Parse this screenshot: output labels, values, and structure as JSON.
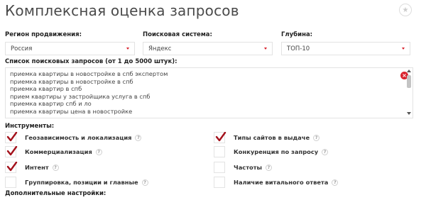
{
  "page": {
    "title": "Комплексная оценка запросов"
  },
  "header": {
    "star_icon": "star-icon"
  },
  "filters": {
    "region": {
      "label": "Регион продвижения:",
      "value": "Россия"
    },
    "engine": {
      "label": "Поисковая система:",
      "value": "Яндекс"
    },
    "depth": {
      "label": "Глубина:",
      "value": "ТОП-10"
    }
  },
  "queries": {
    "label": "Список поисковых запросов (от 1 до 5000 штук):",
    "lines": [
      "приемка квартиры в новостройке в спб экспертом",
      "приемка квартиры в новостройке в спб",
      "приемка квартир в спб",
      "прием квартиры у застройщика услуга в спб",
      "приемка квартир спб и ло",
      "приемка квартиры цена в новостройке"
    ]
  },
  "tools": {
    "label": "Инструменты:",
    "help_glyph": "?",
    "items": [
      {
        "label": "Геозависимость и локализация",
        "checked": true
      },
      {
        "label": "Коммерциализация",
        "checked": true
      },
      {
        "label": "Интент",
        "checked": true
      },
      {
        "label": "Группировка, позиции и главные",
        "checked": false
      },
      {
        "label": "Типы сайтов в выдаче",
        "checked": true
      },
      {
        "label": "Конкуренция по запросу",
        "checked": false
      },
      {
        "label": "Частоты",
        "checked": false
      },
      {
        "label": "Наличие витального ответа",
        "checked": false
      }
    ]
  },
  "extra": {
    "label": "Дополнительные настройки:"
  },
  "colors": {
    "accent": "#d9232e",
    "check": "#a3111b"
  }
}
